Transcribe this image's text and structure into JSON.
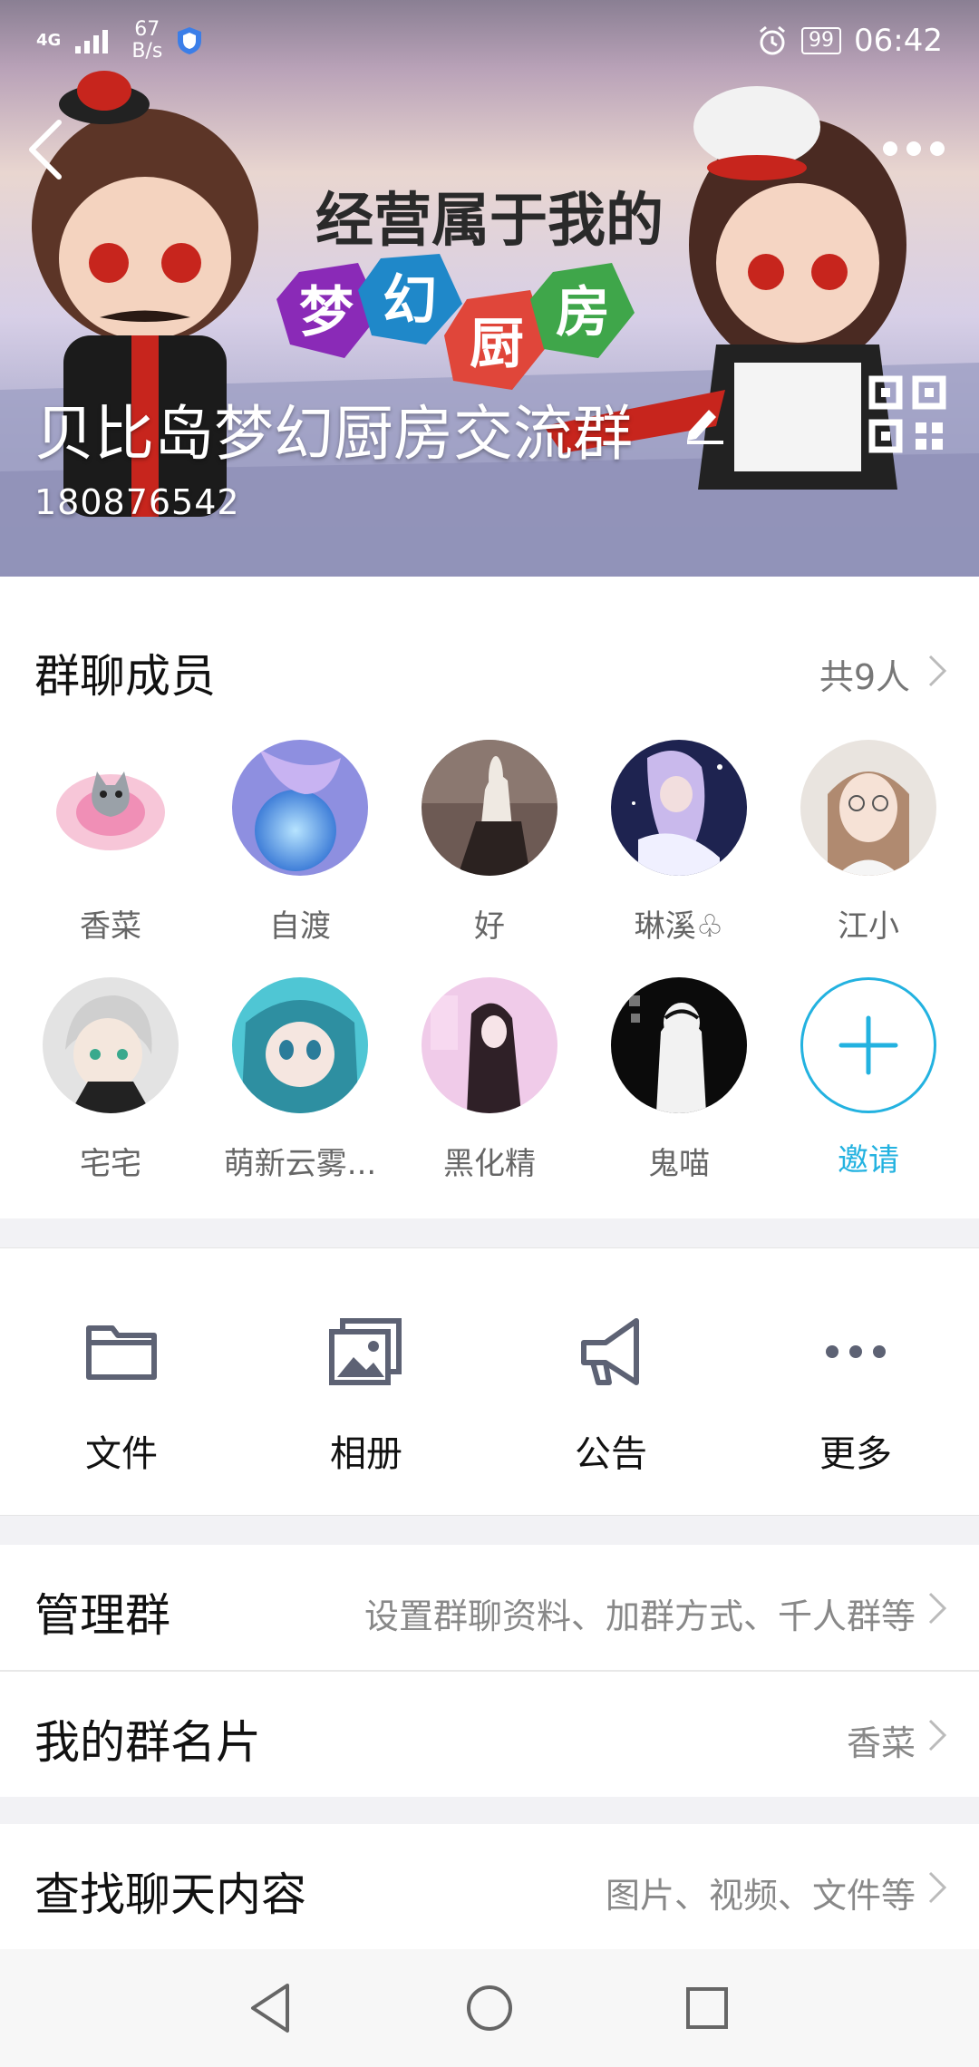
{
  "status_bar": {
    "network": "4G",
    "speed_value": "67",
    "speed_unit": "B/s",
    "battery": "99",
    "time": "06:42"
  },
  "header": {
    "group_name": "贝比岛梦幻厨房交流群",
    "group_id": "180876542",
    "banner_text_line1": "经营属于我的",
    "banner_text_line2": [
      "梦",
      "幻",
      "厨",
      "房"
    ]
  },
  "members": {
    "title": "群聊成员",
    "count": "共9人",
    "list": [
      {
        "name": "香菜",
        "color1": "#f7c6d8",
        "color2": "#9aa1a8"
      },
      {
        "name": "自渡",
        "color1": "#8e8fe0",
        "color2": "#4fa3e8"
      },
      {
        "name": "好",
        "color1": "#e9e4df",
        "color2": "#3b3230"
      },
      {
        "name": "琳溪♧",
        "color1": "#1e2350",
        "color2": "#c9b9ec"
      },
      {
        "name": "江小",
        "color1": "#efe6de",
        "color2": "#b08a70"
      },
      {
        "name": "宅宅",
        "color1": "#e3e3e3",
        "color2": "#39a98d"
      },
      {
        "name": "萌新云雾...",
        "color1": "#4fc6d4",
        "color2": "#2e8fa1"
      },
      {
        "name": "黑化精",
        "color1": "#f0cbe9",
        "color2": "#2f2027"
      },
      {
        "name": "鬼喵",
        "color1": "#0b0b0b",
        "color2": "#f2f2f2"
      }
    ],
    "invite_label": "邀请",
    "accent_color": "#23b2e0"
  },
  "actions": [
    {
      "label": "文件",
      "icon": "folder-icon"
    },
    {
      "label": "相册",
      "icon": "album-icon"
    },
    {
      "label": "公告",
      "icon": "megaphone-icon"
    },
    {
      "label": "更多",
      "icon": "more-dots-icon"
    }
  ],
  "rows": {
    "manage": {
      "title": "管理群",
      "value": "设置群聊资料、加群方式、千人群等"
    },
    "card": {
      "title": "我的群名片",
      "value": "香菜"
    },
    "search": {
      "title": "查找聊天内容",
      "value": "图片、视频、文件等"
    }
  }
}
